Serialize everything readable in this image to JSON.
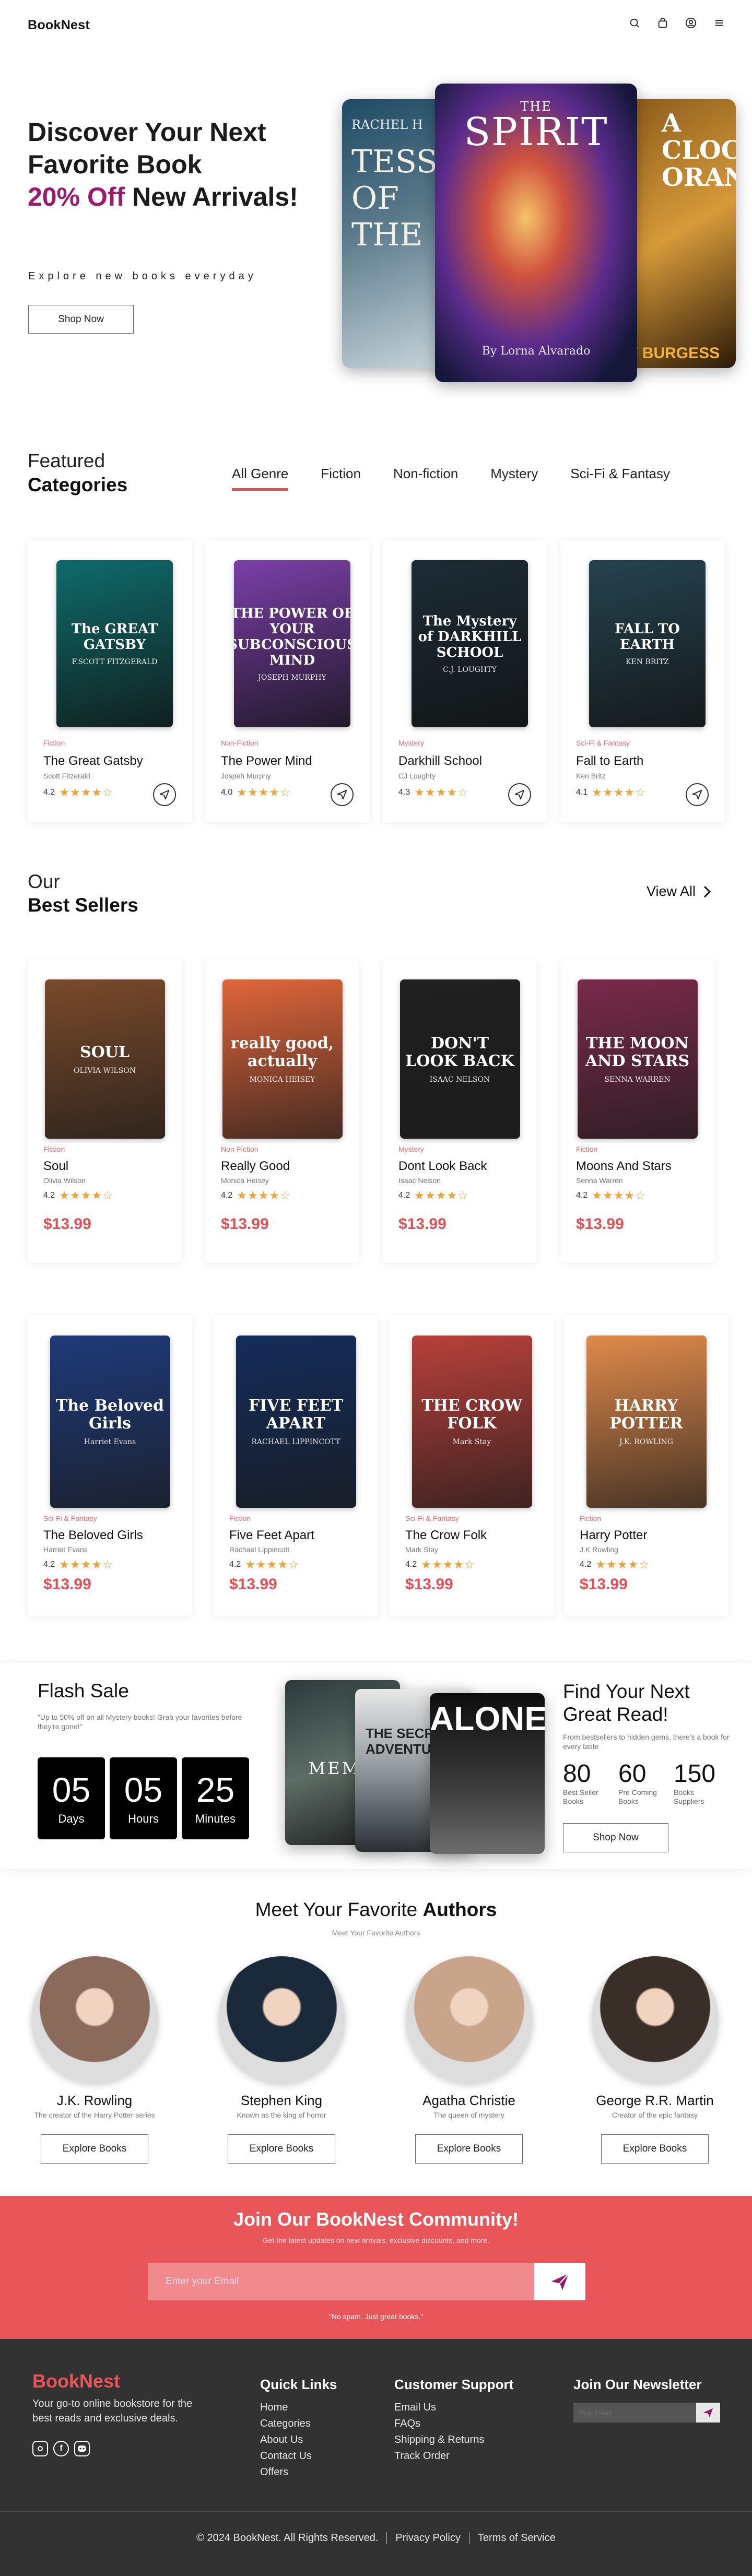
{
  "header": {
    "logo": "BookNest",
    "icons": [
      "search-icon",
      "bag-icon",
      "account-icon",
      "menu-icon"
    ]
  },
  "hero": {
    "title_line1": "Discover Your Next",
    "title_line2": "Favorite Book",
    "title_accent": "20% Off",
    "title_line3_rest": " New Arrivals!",
    "subtitle": "Explore new books everyday",
    "button": "Shop Now",
    "covers": [
      {
        "title": "TESS OF THE",
        "author": "RACHEL H"
      },
      {
        "title": "SPIRIT",
        "prefix": "THE",
        "author": "By Lorna Alvarado"
      },
      {
        "title": "A CLOCKWORK ORANGE",
        "author": "Y BURGESS"
      }
    ]
  },
  "categories": {
    "title1": "Featured",
    "title2": "Categories",
    "tabs": [
      "All Genre",
      "Fiction",
      "Non-fiction",
      "Mystery",
      "Sci-Fi & Fantasy"
    ],
    "active_tab": "All Genre",
    "books": [
      {
        "cover_title": "The GREAT GATSBY",
        "cover_author": "F.SCOTT FITZGERALD",
        "genre": "Fiction",
        "title": "The Great Gatsby",
        "author": "Scott Fitzerald",
        "rating": "4.2",
        "bg": "#0f6b6b"
      },
      {
        "cover_title": "THE POWER OF YOUR SUBCONSCIOUS MIND",
        "cover_author": "JOSEPH MURPHY",
        "genre": "Non-Fiction",
        "title": "The Power Mind",
        "author": "Jospeh Murphy",
        "rating": "4.0",
        "bg": "#7a3fa8"
      },
      {
        "cover_title": "The Mystery of DARKHILL SCHOOL",
        "cover_author": "C.J. LOUGHTY",
        "genre": "Mystery",
        "title": "Darkhill School",
        "author": "CJ Loughty",
        "rating": "4.3",
        "bg": "#1d2c36"
      },
      {
        "cover_title": "FALL TO EARTH",
        "cover_author": "KEN BRITZ",
        "genre": "Sci-Fi & Fantasy",
        "title": "Fall to Earth",
        "author": "Ken Britz",
        "rating": "4.1",
        "bg": "#25434f"
      }
    ]
  },
  "bestsellers": {
    "title1": "Our",
    "title2": "Best Sellers",
    "view_all": "View All",
    "books": [
      {
        "cover_title": "SOUL",
        "cover_author": "OLIVIA WILSON",
        "genre": "Fiction",
        "title": "Soul",
        "author": "Olivia Wilson",
        "rating": "4.2",
        "price": "$13.99",
        "bg": "#7a4a2a"
      },
      {
        "cover_title": "really good, actually",
        "cover_author": "MONICA HEISEY",
        "genre": "Non-Fiction",
        "title": "Really Good",
        "author": "Monica Heisey",
        "rating": "4.2",
        "price": "$13.99",
        "bg": "#e0653a"
      },
      {
        "cover_title": "DON'T LOOK BACK",
        "cover_author": "ISAAC NELSON",
        "genre": "Mystery",
        "title": "Dont Look Back",
        "author": "Isaac Nelson",
        "rating": "4.2",
        "price": "$13.99",
        "bg": "#202020"
      },
      {
        "cover_title": "THE MOON AND STARS",
        "cover_author": "SENNA WARREN",
        "genre": "Fiction",
        "title": "Moons And Stars",
        "author": "Senna Warren",
        "rating": "4.2",
        "price": "$13.99",
        "bg": "#7a2a4a"
      },
      {
        "cover_title": "The Beloved Girls",
        "cover_author": "Harriet Evans",
        "genre": "Sci-Fi & Fantasy",
        "title": "The Beloved Girls",
        "author": "Harriet Evans",
        "rating": "4.2",
        "price": "$13.99",
        "bg": "#1e3a7a"
      },
      {
        "cover_title": "FIVE FEET APART",
        "cover_author": "RACHAEL LIPPINCOTT",
        "genre": "Fiction",
        "title": "Five Feet Apart",
        "author": "Rachael Lippincott",
        "rating": "4.2",
        "price": "$13.99",
        "bg": "#142c5a"
      },
      {
        "cover_title": "THE CROW FOLK",
        "cover_author": "Mark Stay",
        "genre": "Sci-Fi & Fantasy",
        "title": "The Crow Folk",
        "author": "Mark Stay",
        "rating": "4.2",
        "price": "$13.99",
        "bg": "#b8403a"
      },
      {
        "cover_title": "HARRY POTTER",
        "cover_author": "J.K. ROWLING",
        "genre": "Fiction",
        "title": "Harry Potter",
        "author": "J.K Rowling",
        "rating": "4.2",
        "price": "$13.99",
        "bg": "#e08a4a"
      }
    ]
  },
  "flash": {
    "title": "Flash Sale",
    "desc": "\"Up to 50% off on all Mystery books! Grab your favorites before they're gone!\"",
    "timers": [
      {
        "value": "05",
        "label": "Days"
      },
      {
        "value": "05",
        "label": "Hours"
      },
      {
        "value": "25",
        "label": "Minutes"
      }
    ],
    "covers": [
      "MEMO",
      "THE SECRET ADVENTURE",
      "ALONE"
    ],
    "right_title": "Find Your Next Great Read!",
    "right_desc": "From bestsellers to hidden gems, there's a book for every taste",
    "stats": [
      {
        "n": "80",
        "l": "Best Seller Books"
      },
      {
        "n": "60",
        "l": "Pre Coming Books"
      },
      {
        "n": "150",
        "l": "Books Suppliers"
      }
    ],
    "button": "Shop Now"
  },
  "authors": {
    "title_pre": "Meet Your Favorite ",
    "title_bold": "Authors",
    "subtitle": "Meet Your Favorite Authors",
    "button": "Explore Books",
    "list": [
      {
        "name": "J.K. Rowling",
        "desc": "The creator of the Harry Potter series",
        "bg": "#8a6a5a"
      },
      {
        "name": "Stephen King",
        "desc": "Known as the king of horror",
        "bg": "#1b2a3a"
      },
      {
        "name": "Agatha Christie",
        "desc": "The queen of mystery",
        "bg": "#c7a48a"
      },
      {
        "name": "George R.R. Martin",
        "desc": "Creator of the epic fantasy",
        "bg": "#3a2e28"
      }
    ]
  },
  "newsletter": {
    "title": "Join Our BookNest Community!",
    "subtitle": "Get the latest updates on new arrivals, exclusive discounts, and more.",
    "placeholder": "Enter your Email",
    "note": "\"No spam. Just great books.\""
  },
  "footer": {
    "logo": "BookNest",
    "desc": "Your go-to online bookstore for the best reads and exclusive deals.",
    "quick_title": "Quick Links",
    "quick": [
      "Home",
      "Categories",
      "About Us",
      "Contact Us",
      "Offers"
    ],
    "support_title": "Customer Support",
    "support": [
      "Email Us",
      "FAQs",
      "Shipping & Returns",
      "Track Order"
    ],
    "news_title": "Join Our Newsletter",
    "news_placeholder": "Your Email",
    "copyright": "© 2024 BookNest. All Rights Reserved.",
    "privacy": "Privacy Policy",
    "terms": "Terms of Service"
  },
  "colors": {
    "accent": "#e24f54",
    "hero_accent": "#9c1a6a",
    "footer": "#323232",
    "star": "#f0a23a"
  }
}
